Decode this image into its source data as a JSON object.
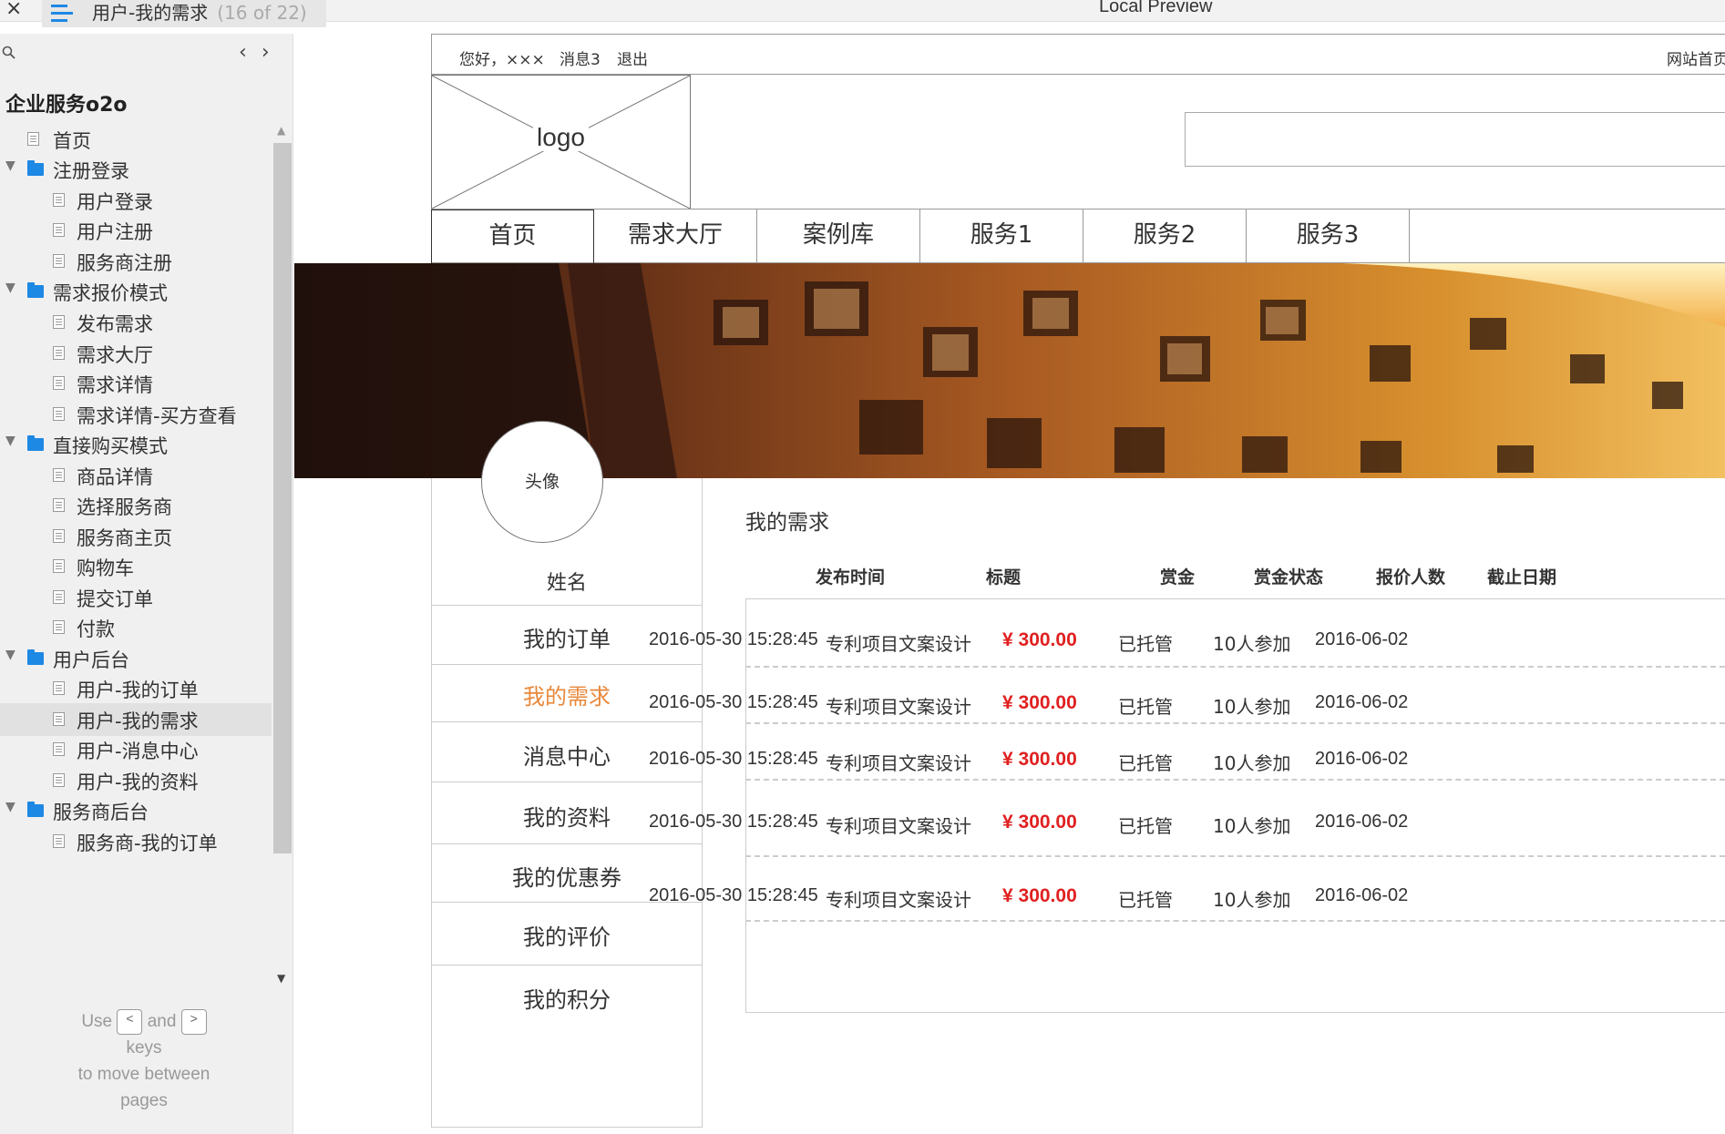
{
  "titlebar": {
    "close": "×",
    "page_title": "用户-我的需求",
    "page_count": "(16 of 22)",
    "preview_label": "Local Preview"
  },
  "leftpanel": {
    "project_title": "企业服务o2o",
    "tree": [
      {
        "label": "首页",
        "type": "page",
        "level": 0
      },
      {
        "label": "注册登录",
        "type": "folder",
        "level": 0
      },
      {
        "label": "用户登录",
        "type": "page",
        "level": 1
      },
      {
        "label": "用户注册",
        "type": "page",
        "level": 1
      },
      {
        "label": "服务商注册",
        "type": "page",
        "level": 1
      },
      {
        "label": "需求报价模式",
        "type": "folder",
        "level": 0
      },
      {
        "label": "发布需求",
        "type": "page",
        "level": 1
      },
      {
        "label": "需求大厅",
        "type": "page",
        "level": 1
      },
      {
        "label": "需求详情",
        "type": "page",
        "level": 1
      },
      {
        "label": "需求详情-买方查看",
        "type": "page",
        "level": 1
      },
      {
        "label": "直接购买模式",
        "type": "folder",
        "level": 0
      },
      {
        "label": "商品详情",
        "type": "page",
        "level": 1
      },
      {
        "label": "选择服务商",
        "type": "page",
        "level": 1
      },
      {
        "label": "服务商主页",
        "type": "page",
        "level": 1
      },
      {
        "label": "购物车",
        "type": "page",
        "level": 1
      },
      {
        "label": "提交订单",
        "type": "page",
        "level": 1
      },
      {
        "label": "付款",
        "type": "page",
        "level": 1
      },
      {
        "label": "用户后台",
        "type": "folder",
        "level": 0
      },
      {
        "label": "用户-我的订单",
        "type": "page",
        "level": 1
      },
      {
        "label": "用户-我的需求",
        "type": "page",
        "level": 1,
        "selected": true
      },
      {
        "label": "用户-消息中心",
        "type": "page",
        "level": 1
      },
      {
        "label": "用户-我的资料",
        "type": "page",
        "level": 1
      },
      {
        "label": "服务商后台",
        "type": "folder",
        "level": 0
      },
      {
        "label": "服务商-我的订单",
        "type": "page",
        "level": 1
      }
    ],
    "help": {
      "use": "Use",
      "key_prev": "<",
      "and": "and",
      "key_next": ">",
      "keys": "keys",
      "line": "to move between",
      "pages": "pages"
    }
  },
  "site": {
    "greeting": "您好，×××",
    "messages": "消息3",
    "logout": "退出",
    "home_link": "网站首页",
    "logo": "logo",
    "nav": [
      "首页",
      "需求大厅",
      "案例库",
      "服务1",
      "服务2",
      "服务3"
    ],
    "avatar": "头像",
    "username": "姓名",
    "menu": [
      "我的订单",
      "我的需求",
      "消息中心",
      "我的资料",
      "我的优惠券",
      "我的评价",
      "我的积分"
    ],
    "active_menu": "我的需求",
    "content_title": "我的需求",
    "table": {
      "headers": [
        "发布时间",
        "标题",
        "赏金",
        "赏金状态",
        "报价人数",
        "截止日期"
      ],
      "rows": [
        [
          "2016-05-30  15:28:45",
          "专利项目文案设计",
          "¥ 300.00",
          "已托管",
          "10人参加",
          "2016-06-02"
        ],
        [
          "2016-05-30  15:28:45",
          "专利项目文案设计",
          "¥ 300.00",
          "已托管",
          "10人参加",
          "2016-06-02"
        ],
        [
          "2016-05-30  15:28:45",
          "专利项目文案设计",
          "¥ 300.00",
          "已托管",
          "10人参加",
          "2016-06-02"
        ],
        [
          "2016-05-30  15:28:45",
          "专利项目文案设计",
          "¥ 300.00",
          "已托管",
          "10人参加",
          "2016-06-02"
        ],
        [
          "2016-05-30  15:28:45",
          "专利项目文案设计",
          "¥ 300.00",
          "已托管",
          "10人参加",
          "2016-06-02"
        ]
      ]
    }
  },
  "colors": {
    "accent": "#1e88e5",
    "active_menu": "#e8883a",
    "price": "#e02020"
  }
}
